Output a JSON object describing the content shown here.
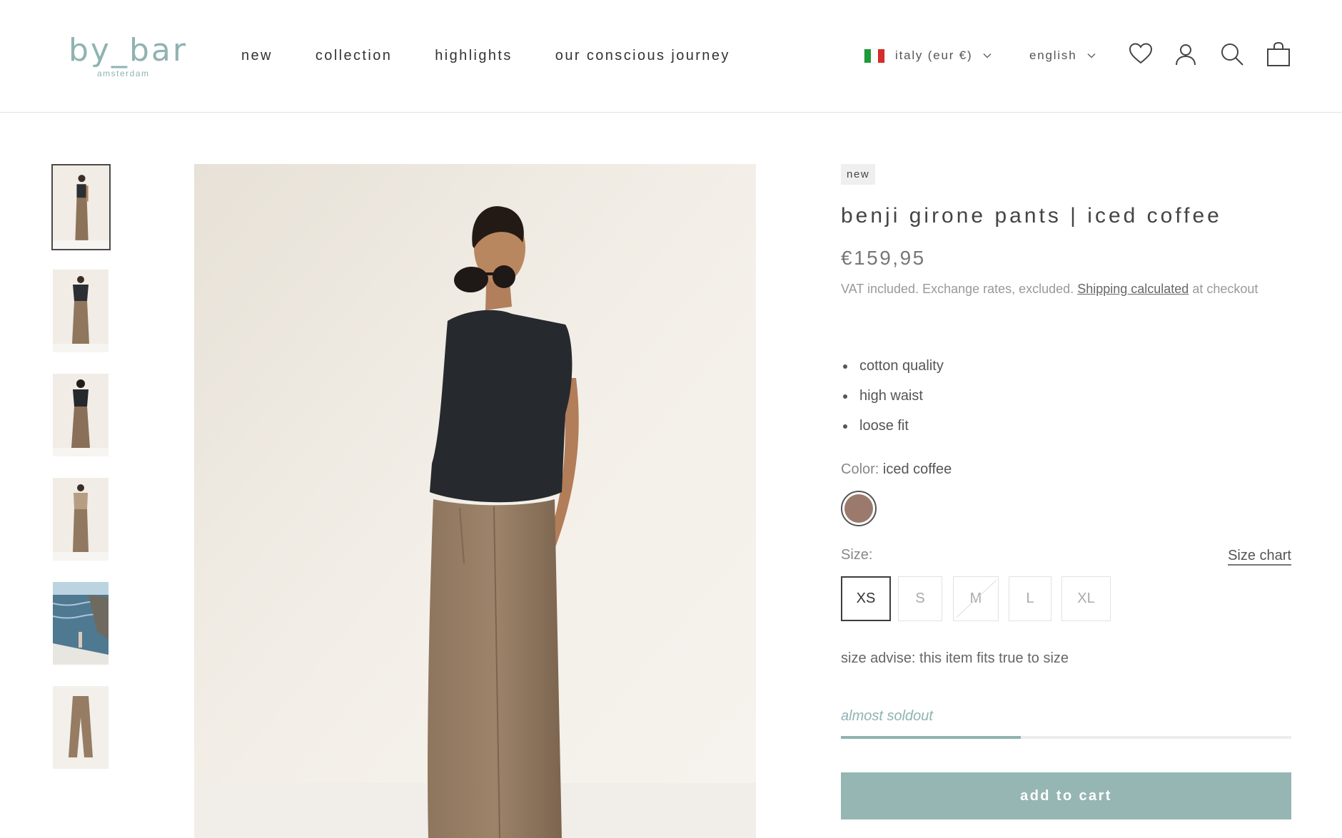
{
  "brand": {
    "logo_main": "by_bar",
    "logo_sub": "amsterdam",
    "accent": "#8fb3b1"
  },
  "nav": [
    {
      "label": "new"
    },
    {
      "label": "collection"
    },
    {
      "label": "highlights"
    },
    {
      "label": "our conscious journey"
    }
  ],
  "header": {
    "country": "italy (eur €)",
    "language": "english",
    "icons": [
      "wishlist-heart-icon",
      "account-icon",
      "search-icon",
      "cart-bag-icon"
    ]
  },
  "gallery": {
    "thumbnails": [
      {
        "name": "model-front",
        "selected": true
      },
      {
        "name": "model-front-full"
      },
      {
        "name": "model-back"
      },
      {
        "name": "model-beige-outfit"
      },
      {
        "name": "seaside-lifestyle"
      },
      {
        "name": "pants-flatlay"
      }
    ]
  },
  "product": {
    "badge": "new",
    "title": "benji girone pants | iced coffee",
    "price": "€159,95",
    "vat_prefix": "VAT included. Exchange rates, excluded. ",
    "vat_link": "Shipping calculated",
    "vat_suffix": " at checkout",
    "features": [
      "cotton quality",
      "high waist",
      "loose fit"
    ],
    "color_label": "Color:",
    "color_value": "iced coffee",
    "swatch_color": "#9b7a6d",
    "size_label": "Size:",
    "size_chart_label": "Size chart",
    "sizes": [
      {
        "label": "XS",
        "selected": true,
        "available": true
      },
      {
        "label": "S",
        "available": true
      },
      {
        "label": "M",
        "available": false
      },
      {
        "label": "L",
        "available": true
      },
      {
        "label": "XL",
        "available": true
      }
    ],
    "size_advice": "size advise: this item fits true to size",
    "stock_label": "almost soldout",
    "stock_level": 0.4,
    "add_to_cart": "add to cart",
    "button_color": "#96b6b3"
  }
}
